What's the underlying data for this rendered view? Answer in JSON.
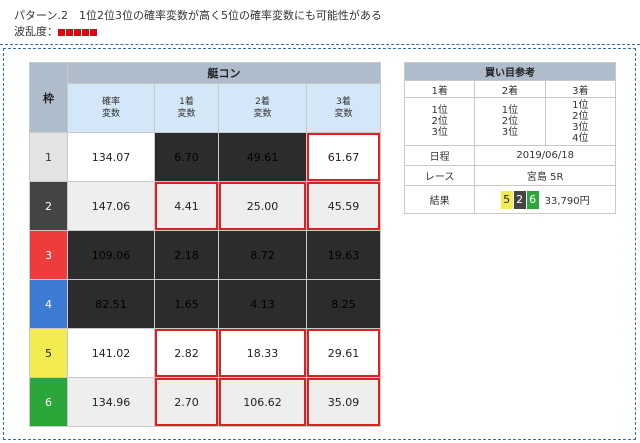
{
  "header": {
    "pattern_text": "パターン.2　1位2位3位の確率変数が高く5位の確率変数にも可能性がある",
    "wave_label": "波乱度：",
    "wave_level": 5,
    "wave_color": "#e60012"
  },
  "main_table": {
    "waku_header": "枠",
    "group_header": "艇コン",
    "columns": [
      {
        "l1": "確率",
        "l2": "変数"
      },
      {
        "l1": "1着",
        "l2": "変数"
      },
      {
        "l1": "2着",
        "l2": "変数"
      },
      {
        "l1": "3着",
        "l2": "変数"
      }
    ],
    "rows": [
      {
        "waku": "1",
        "waku_color": "#e3e3e3",
        "values": [
          "134.07",
          "6.70",
          "49.61",
          "61.67"
        ]
      },
      {
        "waku": "2",
        "waku_color": "#444444",
        "values": [
          "147.06",
          "4.41",
          "25.00",
          "45.59"
        ]
      },
      {
        "waku": "3",
        "waku_color": "#ee3b3b",
        "values": [
          "109.06",
          "2.18",
          "8.72",
          "19.63"
        ]
      },
      {
        "waku": "4",
        "waku_color": "#3b7bd4",
        "values": [
          "82.51",
          "1.65",
          "4.13",
          "8.25"
        ]
      },
      {
        "waku": "5",
        "waku_color": "#f2ec52",
        "values": [
          "141.02",
          "2.82",
          "18.33",
          "29.61"
        ]
      },
      {
        "waku": "6",
        "waku_color": "#2aa63a",
        "values": [
          "134.96",
          "2.70",
          "106.62",
          "35.09"
        ]
      }
    ]
  },
  "side_table": {
    "title": "買い目参考",
    "headers": [
      "1着",
      "2着",
      "3着"
    ],
    "picks": [
      [
        "1位",
        "2位",
        "3位"
      ],
      [
        "1位",
        "2位",
        "3位"
      ],
      [
        "1位",
        "2位",
        "3位",
        "4位"
      ]
    ],
    "date_label": "日程",
    "date_value": "2019/06/18",
    "race_label": "レース",
    "race_value": "宮島 5R",
    "result_label": "結果",
    "result_boats": [
      "5",
      "2",
      "6"
    ],
    "result_payout": "33,790円"
  }
}
